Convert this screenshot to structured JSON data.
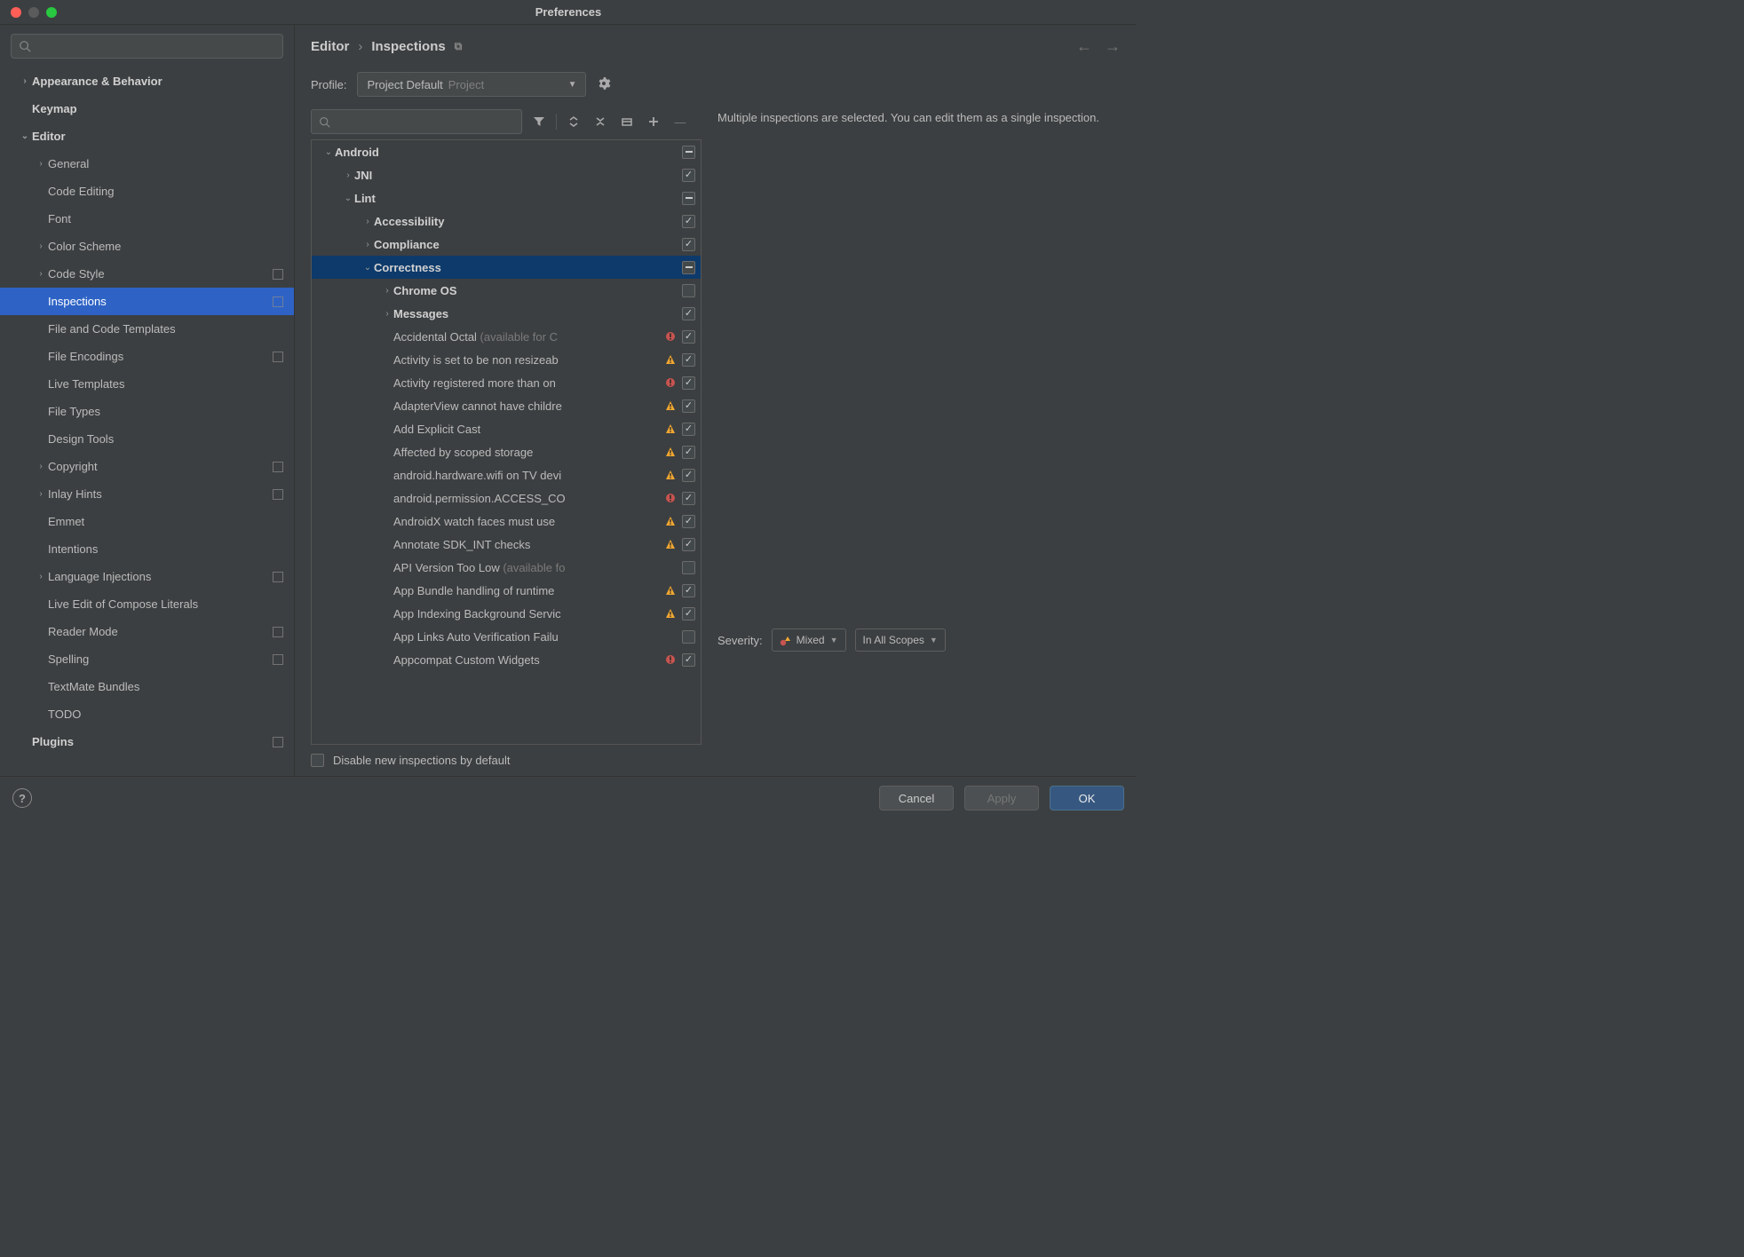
{
  "window": {
    "title": "Preferences"
  },
  "breadcrumb": {
    "parent": "Editor",
    "current": "Inspections"
  },
  "profile": {
    "label": "Profile:",
    "name": "Project Default",
    "scope": "Project"
  },
  "sidebar": [
    {
      "label": "Appearance & Behavior",
      "expandable": true,
      "expanded": false,
      "bold": true,
      "depth": 0
    },
    {
      "label": "Keymap",
      "bold": true,
      "depth": 0
    },
    {
      "label": "Editor",
      "expandable": true,
      "expanded": true,
      "bold": true,
      "depth": 0
    },
    {
      "label": "General",
      "expandable": true,
      "depth": 1
    },
    {
      "label": "Code Editing",
      "depth": 1
    },
    {
      "label": "Font",
      "depth": 1
    },
    {
      "label": "Color Scheme",
      "expandable": true,
      "depth": 1
    },
    {
      "label": "Code Style",
      "expandable": true,
      "depth": 1,
      "proj": true
    },
    {
      "label": "Inspections",
      "depth": 1,
      "selected": true,
      "proj": true
    },
    {
      "label": "File and Code Templates",
      "depth": 1
    },
    {
      "label": "File Encodings",
      "depth": 1,
      "proj": true
    },
    {
      "label": "Live Templates",
      "depth": 1
    },
    {
      "label": "File Types",
      "depth": 1
    },
    {
      "label": "Design Tools",
      "depth": 1
    },
    {
      "label": "Copyright",
      "expandable": true,
      "depth": 1,
      "proj": true
    },
    {
      "label": "Inlay Hints",
      "expandable": true,
      "depth": 1,
      "proj": true
    },
    {
      "label": "Emmet",
      "depth": 1
    },
    {
      "label": "Intentions",
      "depth": 1
    },
    {
      "label": "Language Injections",
      "expandable": true,
      "depth": 1,
      "proj": true
    },
    {
      "label": "Live Edit of Compose Literals",
      "depth": 1
    },
    {
      "label": "Reader Mode",
      "depth": 1,
      "proj": true
    },
    {
      "label": "Spelling",
      "depth": 1,
      "proj": true
    },
    {
      "label": "TextMate Bundles",
      "depth": 1
    },
    {
      "label": "TODO",
      "depth": 1
    },
    {
      "label": "Plugins",
      "bold": true,
      "depth": 0,
      "proj": true
    }
  ],
  "inspectionTree": [
    {
      "depth": 0,
      "label": "Android",
      "bold": true,
      "expandable": true,
      "expanded": true,
      "state": "indet"
    },
    {
      "depth": 1,
      "label": "JNI",
      "bold": true,
      "expandable": true,
      "state": "checked"
    },
    {
      "depth": 1,
      "label": "Lint",
      "bold": true,
      "expandable": true,
      "expanded": true,
      "state": "indet"
    },
    {
      "depth": 2,
      "label": "Accessibility",
      "bold": true,
      "expandable": true,
      "state": "checked"
    },
    {
      "depth": 2,
      "label": "Compliance",
      "bold": true,
      "expandable": true,
      "state": "checked"
    },
    {
      "depth": 2,
      "label": "Correctness",
      "bold": true,
      "expandable": true,
      "expanded": true,
      "state": "indet",
      "selected": true
    },
    {
      "depth": 3,
      "label": "Chrome OS",
      "bold": true,
      "expandable": true,
      "state": "unchecked"
    },
    {
      "depth": 3,
      "label": "Messages",
      "bold": true,
      "expandable": true,
      "state": "checked"
    },
    {
      "depth": 3,
      "label": "Accidental Octal",
      "muted": "(available for C",
      "sev": "err",
      "state": "checked"
    },
    {
      "depth": 3,
      "label": "Activity is set to be non resizeab",
      "sev": "warn",
      "state": "checked"
    },
    {
      "depth": 3,
      "label": "Activity registered more than on",
      "sev": "err",
      "state": "checked"
    },
    {
      "depth": 3,
      "label": "AdapterView cannot have childre",
      "sev": "warn",
      "state": "checked"
    },
    {
      "depth": 3,
      "label": "Add Explicit Cast",
      "sev": "warn",
      "state": "checked"
    },
    {
      "depth": 3,
      "label": "Affected by scoped storage",
      "sev": "warn",
      "state": "checked"
    },
    {
      "depth": 3,
      "label": "android.hardware.wifi on TV devi",
      "sev": "warn",
      "state": "checked"
    },
    {
      "depth": 3,
      "label": "android.permission.ACCESS_CO",
      "sev": "err",
      "state": "checked"
    },
    {
      "depth": 3,
      "label": "AndroidX watch faces must use",
      "sev": "warn",
      "state": "checked"
    },
    {
      "depth": 3,
      "label": "Annotate SDK_INT checks",
      "sev": "warn",
      "state": "checked"
    },
    {
      "depth": 3,
      "label": "API Version Too Low",
      "muted": "(available fo",
      "state": "unchecked"
    },
    {
      "depth": 3,
      "label": "App Bundle handling of runtime ",
      "sev": "warn",
      "state": "checked"
    },
    {
      "depth": 3,
      "label": "App Indexing Background Servic",
      "sev": "warn",
      "state": "checked"
    },
    {
      "depth": 3,
      "label": "App Links Auto Verification Failu",
      "state": "unchecked"
    },
    {
      "depth": 3,
      "label": "Appcompat Custom Widgets",
      "sev": "err",
      "state": "checked"
    }
  ],
  "disableNew": {
    "label": "Disable new inspections by default",
    "checked": false
  },
  "detail": {
    "text": "Multiple inspections are selected. You can edit them as a single inspection."
  },
  "severity": {
    "label": "Severity:",
    "value": "Mixed",
    "scope": "In All Scopes"
  },
  "buttons": {
    "cancel": "Cancel",
    "apply": "Apply",
    "ok": "OK"
  }
}
